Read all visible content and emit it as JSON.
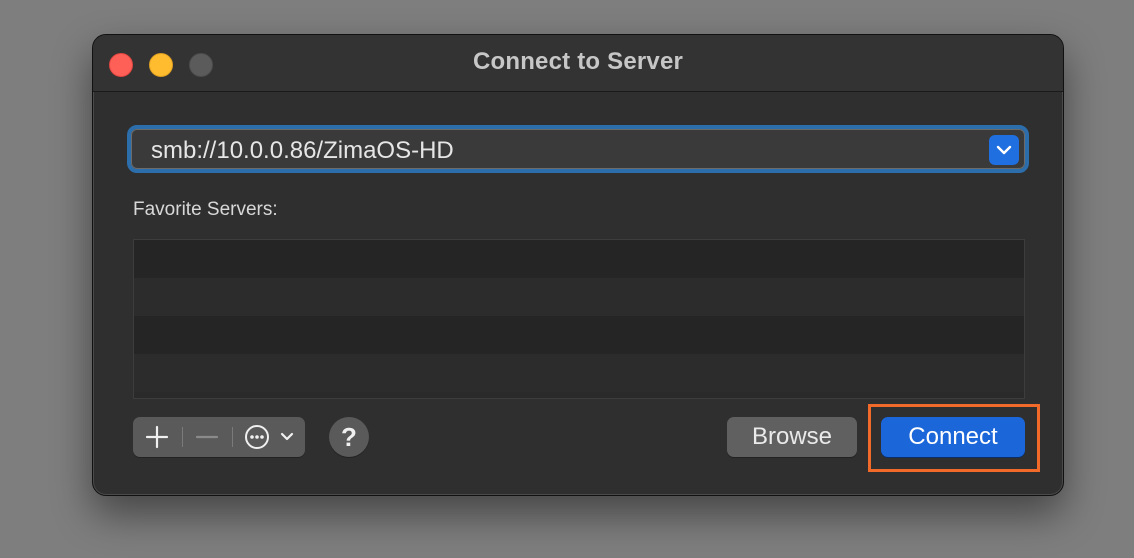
{
  "window": {
    "title": "Connect to Server"
  },
  "server_address": {
    "value": "smb://10.0.0.86/ZimaOS-HD"
  },
  "favorites": {
    "label": "Favorite Servers:",
    "rows": [
      "",
      "",
      "",
      ""
    ]
  },
  "toolbar": {
    "add_icon": "plus-icon",
    "remove_icon": "minus-icon",
    "more_icon": "ellipsis-circle-icon",
    "help_label": "?"
  },
  "buttons": {
    "browse_label": "Browse",
    "connect_label": "Connect"
  },
  "colors": {
    "accent": "#1b66d8",
    "focus_ring": "#2c6eab",
    "highlight": "#f26a2a"
  }
}
